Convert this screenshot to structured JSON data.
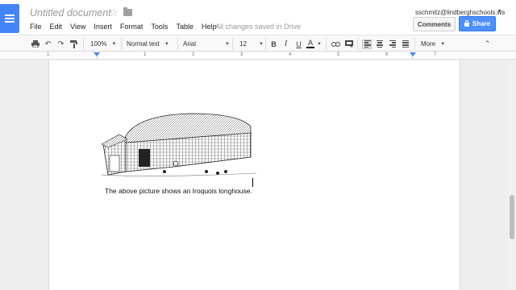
{
  "header": {
    "doc_title": "Untitled document",
    "save_status": "All changes saved in Drive",
    "user_email": "sschmitz@lindberghschools.ws",
    "comments_label": "Comments",
    "share_label": "Share"
  },
  "menu": [
    "File",
    "Edit",
    "View",
    "Insert",
    "Format",
    "Tools",
    "Table",
    "Help"
  ],
  "toolbar": {
    "zoom": "100%",
    "style": "Normal text",
    "font": "Arial",
    "size": "12",
    "bold": "B",
    "italic": "I",
    "underline": "U",
    "text_color": "A",
    "more": "More"
  },
  "ruler": {
    "labels": [
      "1",
      "1",
      "2",
      "3",
      "4",
      "5",
      "6",
      "7"
    ]
  },
  "document": {
    "caption": "The above picture shows an Iroquois longhouse."
  },
  "colors": {
    "accent": "#4285f4",
    "share": "#4d90fe"
  }
}
